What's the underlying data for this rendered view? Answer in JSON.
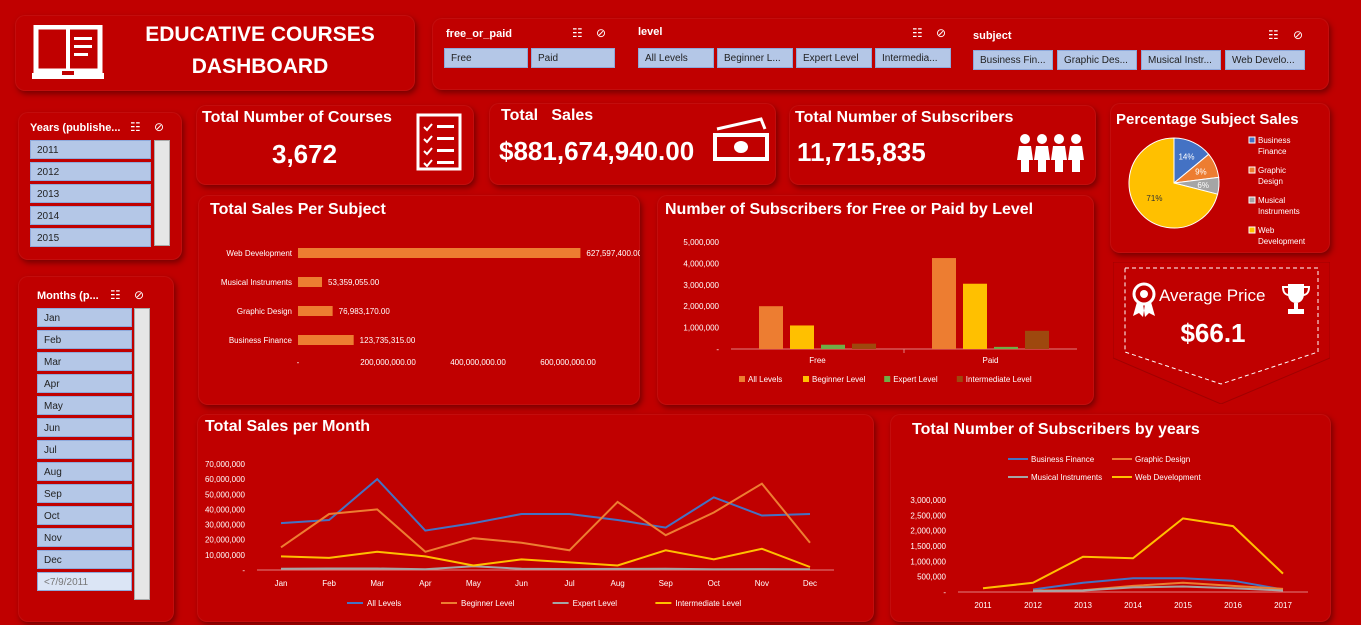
{
  "header": {
    "title_line1": "EDUCATIVE COURSES",
    "title_line2": "DASHBOARD"
  },
  "slicers": {
    "free_or_paid": {
      "title": "free_or_paid",
      "items": [
        "Free",
        "Paid"
      ]
    },
    "level": {
      "title": "level",
      "items": [
        "All Levels",
        "Beginner L...",
        "Expert Level",
        "Intermedia..."
      ]
    },
    "subject": {
      "title": "subject",
      "items": [
        "Business Fin...",
        "Graphic Des...",
        "Musical Instr...",
        "Web Develo..."
      ]
    },
    "years": {
      "title": "Years (publishe...",
      "items": [
        "2011",
        "2012",
        "2013",
        "2014",
        "2015"
      ]
    },
    "months": {
      "title": "Months (p...",
      "items": [
        "Jan",
        "Feb",
        "Mar",
        "Apr",
        "May",
        "Jun",
        "Jul",
        "Aug",
        "Sep",
        "Oct",
        "Nov",
        "Dec",
        "<7/9/2011"
      ]
    }
  },
  "kpis": {
    "courses": {
      "title": "Total Number of Courses",
      "value": "3,672"
    },
    "sales": {
      "title": "Total   Sales",
      "value": "$881,674,940.00"
    },
    "subscribers": {
      "title": "Total Number of Subscribers",
      "value": "11,715,835"
    },
    "avg_price": {
      "title": "Average Price",
      "value": "$66.1"
    }
  },
  "colors": {
    "background": "#c00000",
    "orange": "#ed7d31",
    "yellow": "#ffc000",
    "blue": "#4472c4",
    "grey": "#a5a5a5",
    "green": "#70ad47",
    "brown": "#9e480e",
    "chip": "#b4c7e7"
  },
  "icons": [
    "book-icon",
    "checklist-icon",
    "money-icon",
    "people-icon",
    "ribbon-icon",
    "trophy-icon",
    "multi-select-icon",
    "clear-filter-icon"
  ],
  "chart_data": [
    {
      "id": "sales_per_subject",
      "type": "bar",
      "title": "Total Sales Per Subject",
      "orientation": "horizontal",
      "categories": [
        "Web Development",
        "Musical Instruments",
        "Graphic Design",
        "Business Finance"
      ],
      "values": [
        627597400,
        53359055,
        76983170,
        123735315
      ],
      "value_labels": [
        "627,597,400.00",
        "53,359,055.00",
        "76,983,170.00",
        "123,735,315.00"
      ],
      "xticks": [
        "-",
        "200,000,000.00",
        "400,000,000.00",
        "600,000,000.00"
      ],
      "xlim": [
        0,
        700000000
      ],
      "color": "#ed7d31"
    },
    {
      "id": "subscribers_free_paid",
      "type": "bar",
      "title": "Number of Subscribers for Free or Paid by Level",
      "categories": [
        "Free",
        "Paid"
      ],
      "series": [
        {
          "name": "All Levels",
          "values": [
            2000000,
            4250000
          ],
          "color": "#ed7d31"
        },
        {
          "name": "Beginner Level",
          "values": [
            1100000,
            3050000
          ],
          "color": "#ffc000"
        },
        {
          "name": "Expert Level",
          "values": [
            200000,
            100000
          ],
          "color": "#70ad47"
        },
        {
          "name": "Intermediate Level",
          "values": [
            250000,
            850000
          ],
          "color": "#9e480e"
        }
      ],
      "yticks": [
        "-",
        "1,000,000",
        "2,000,000",
        "3,000,000",
        "4,000,000",
        "5,000,000"
      ],
      "ylim": [
        0,
        5000000
      ]
    },
    {
      "id": "subject_share",
      "type": "pie",
      "title": "Percentage Subject Sales",
      "labels": [
        "Business Finance",
        "Graphic Design",
        "Musical Instruments",
        "Web Development"
      ],
      "values": [
        14,
        9,
        6,
        71
      ],
      "value_labels": [
        "14%",
        "9%",
        "6%",
        "71%"
      ],
      "colors": [
        "#4472c4",
        "#ed7d31",
        "#a5a5a5",
        "#ffc000"
      ],
      "legend": "right"
    },
    {
      "id": "sales_per_month",
      "type": "line",
      "title": "Total Sales per Month",
      "x": [
        "Jan",
        "Feb",
        "Mar",
        "Apr",
        "May",
        "Jun",
        "Jul",
        "Aug",
        "Sep",
        "Oct",
        "Nov",
        "Dec"
      ],
      "series": [
        {
          "name": "All Levels",
          "values": [
            31000000,
            33000000,
            60000000,
            26000000,
            31000000,
            37000000,
            37000000,
            33000000,
            28000000,
            48000000,
            36000000,
            37000000
          ],
          "color": "#4472c4"
        },
        {
          "name": "Beginner Level",
          "values": [
            15000000,
            37000000,
            40000000,
            12000000,
            21000000,
            18000000,
            13000000,
            45000000,
            23000000,
            38000000,
            57000000,
            18000000
          ],
          "color": "#ed7d31"
        },
        {
          "name": "Expert Level",
          "values": [
            800000,
            1000000,
            1000000,
            500000,
            2500000,
            800000,
            600000,
            700000,
            800000,
            500000,
            600000,
            500000
          ],
          "color": "#a5a5a5"
        },
        {
          "name": "Intermediate Level",
          "values": [
            9000000,
            8000000,
            12000000,
            9000000,
            3000000,
            7000000,
            5000000,
            3000000,
            13000000,
            7000000,
            14000000,
            2000000
          ],
          "color": "#ffc000"
        }
      ],
      "yticks": [
        "-",
        "10,000,000",
        "20,000,000",
        "30,000,000",
        "40,000,000",
        "50,000,000",
        "60,000,000",
        "70,000,000"
      ],
      "ylim": [
        0,
        70000000
      ]
    },
    {
      "id": "subscribers_by_year",
      "type": "line",
      "title": "Total Number of Subscribers by years",
      "x": [
        "2011",
        "2012",
        "2013",
        "2014",
        "2015",
        "2016",
        "2017"
      ],
      "series": [
        {
          "name": "Business Finance",
          "values": [
            null,
            80000,
            300000,
            450000,
            450000,
            370000,
            80000
          ],
          "color": "#4472c4"
        },
        {
          "name": "Graphic Design",
          "values": [
            null,
            50000,
            60000,
            200000,
            300000,
            200000,
            100000
          ],
          "color": "#ed7d31"
        },
        {
          "name": "Musical Instruments",
          "values": [
            null,
            30000,
            50000,
            150000,
            180000,
            120000,
            50000
          ],
          "color": "#a5a5a5"
        },
        {
          "name": "Web Development",
          "values": [
            120000,
            300000,
            1150000,
            1100000,
            2400000,
            2150000,
            600000
          ],
          "color": "#ffc000"
        }
      ],
      "yticks": [
        "-",
        "500,000",
        "1,000,000",
        "1,500,000",
        "2,000,000",
        "2,500,000",
        "3,000,000"
      ],
      "ylim": [
        0,
        3000000
      ],
      "legend": "top"
    }
  ]
}
